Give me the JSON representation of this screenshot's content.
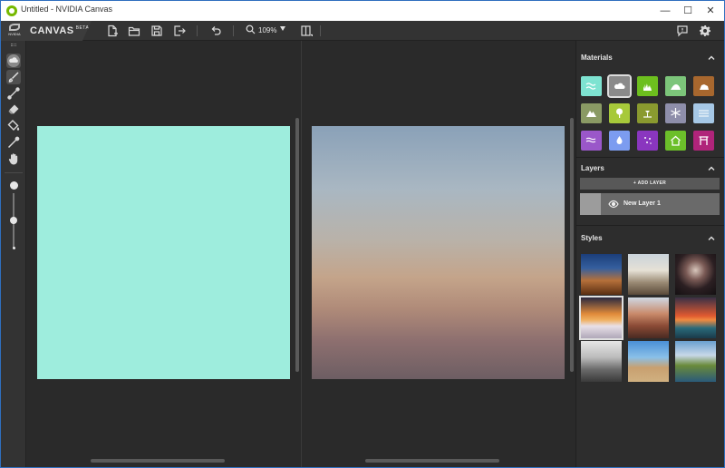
{
  "window": {
    "title": "Untitled - NVIDIA Canvas",
    "minimize": "—",
    "maximize": "☐",
    "close": "✕"
  },
  "brand": {
    "logo_text": "NVIDIA",
    "product": "CANVAS",
    "beta": "BETA"
  },
  "toolbar": {
    "zoom": "109%",
    "icons": [
      "new-file-icon",
      "open-folder-icon",
      "save-icon",
      "export-icon",
      "undo-icon",
      "zoom-icon",
      "toggle-view-icon"
    ]
  },
  "tools": [
    "material-cloud",
    "brush",
    "line",
    "eraser",
    "fill",
    "eyedropper",
    "pan"
  ],
  "brush_size_level": 0.5,
  "colors": {
    "paint_canvas": "#9eeddd",
    "accent": "#76b900"
  },
  "sidebar": {
    "materials": {
      "title": "Materials",
      "items": [
        {
          "name": "sea",
          "color": "#7ee3d1",
          "icon": "waves-icon"
        },
        {
          "name": "cloud",
          "color": "#8a8a8a",
          "icon": "cloud-icon",
          "selected": true
        },
        {
          "name": "grass",
          "color": "#6dbf1e",
          "icon": "grass-icon"
        },
        {
          "name": "hill",
          "color": "#7cc57a",
          "icon": "hill-icon"
        },
        {
          "name": "rock",
          "color": "#a8672e",
          "icon": "rock-icon"
        },
        {
          "name": "mountain",
          "color": "#8a9a64",
          "icon": "mountain-icon"
        },
        {
          "name": "tree",
          "color": "#a7c93a",
          "icon": "tree-icon"
        },
        {
          "name": "sand",
          "color": "#8a9a2f",
          "icon": "beach-icon"
        },
        {
          "name": "snow",
          "color": "#8e8eaa",
          "icon": "snowflake-icon"
        },
        {
          "name": "water",
          "color": "#a6c8e6",
          "icon": "water-icon"
        },
        {
          "name": "river",
          "color": "#9a57c9",
          "icon": "river-icon"
        },
        {
          "name": "fog",
          "color": "#7c9cf0",
          "icon": "drop-icon"
        },
        {
          "name": "flower",
          "color": "#8a36bf",
          "icon": "sparkle-icon"
        },
        {
          "name": "building",
          "color": "#6cbf2a",
          "icon": "house-icon"
        },
        {
          "name": "bridge",
          "color": "#b0247a",
          "icon": "gate-icon"
        }
      ]
    },
    "layers": {
      "title": "Layers",
      "add_label": "+ ADD LAYER",
      "items": [
        {
          "name": "New Layer 1"
        }
      ]
    },
    "styles": {
      "title": "Styles",
      "count": 9,
      "selected_index": 3
    }
  }
}
